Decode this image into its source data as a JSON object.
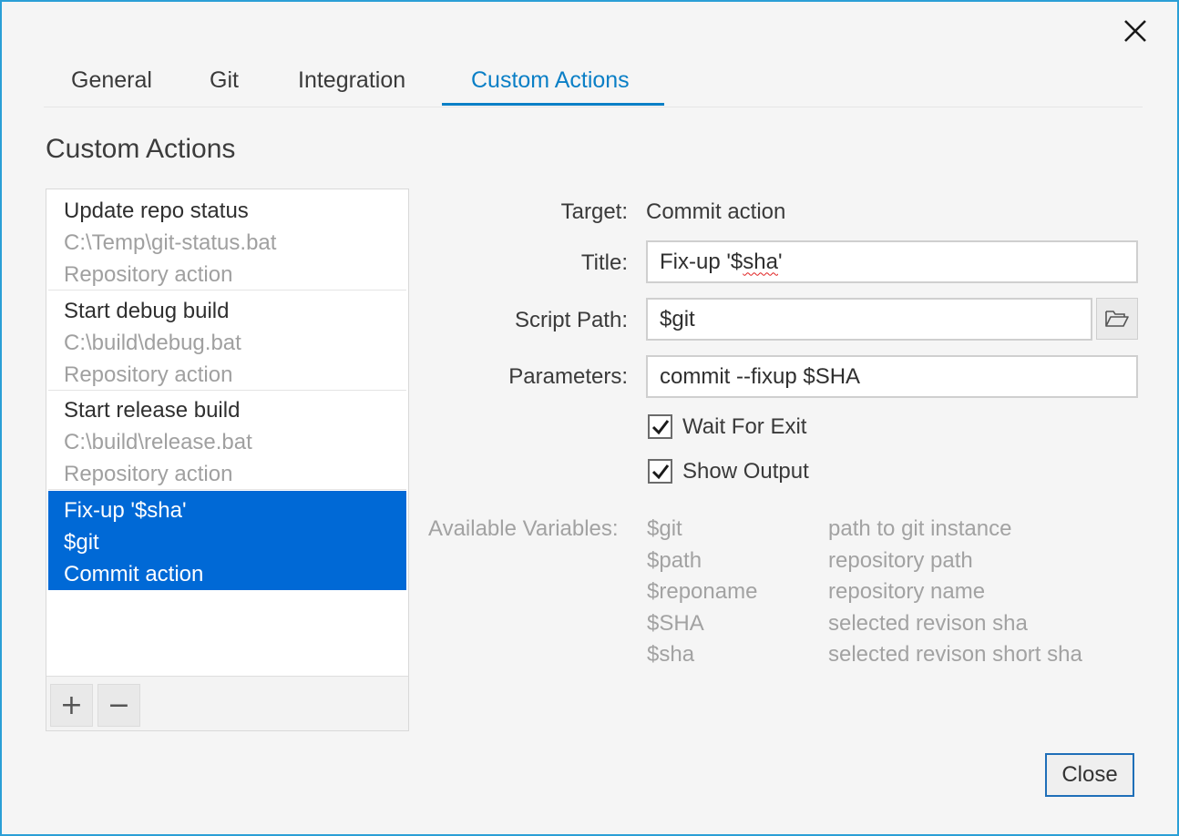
{
  "tabs": [
    {
      "label": "General"
    },
    {
      "label": "Git"
    },
    {
      "label": "Integration"
    },
    {
      "label": "Custom Actions"
    }
  ],
  "active_tab": "Custom Actions",
  "section_title": "Custom Actions",
  "actions": [
    {
      "title": "Update repo status",
      "path": "C:\\Temp\\git-status.bat",
      "target": "Repository action"
    },
    {
      "title": "Start debug build",
      "path": "C:\\build\\debug.bat",
      "target": "Repository action"
    },
    {
      "title": "Start release build",
      "path": "C:\\build\\release.bat",
      "target": "Repository action"
    },
    {
      "title": "Fix-up '$sha'",
      "path": "$git",
      "target": "Commit action"
    }
  ],
  "list_toolbar": {
    "add_label": "+",
    "remove_label": "−"
  },
  "form": {
    "target_label": "Target:",
    "target_value": "Commit action",
    "title_label": "Title:",
    "title_value_prefix": "Fix-up '$",
    "title_value_flagged": "sha",
    "title_value_suffix": "'",
    "script_path_label": "Script Path:",
    "script_path_value": "$git",
    "parameters_label": "Parameters:",
    "parameters_value": "commit --fixup $SHA",
    "wait_for_exit_label": "Wait For Exit",
    "wait_for_exit_checked": true,
    "show_output_label": "Show Output",
    "show_output_checked": true
  },
  "variables": {
    "label": "Available Variables:",
    "items": [
      {
        "name": "$git",
        "desc": "path to git instance"
      },
      {
        "name": "$path",
        "desc": "repository path"
      },
      {
        "name": "$reponame",
        "desc": "repository name"
      },
      {
        "name": "$SHA",
        "desc": "selected revison sha"
      },
      {
        "name": "$sha",
        "desc": "selected revison short sha"
      }
    ]
  },
  "close_button_label": "Close",
  "icons": {
    "dialog_close": "close-icon",
    "browse": "folder-open-icon",
    "checkbox": "checkmark-icon"
  },
  "colors": {
    "accent": "#0a7fc6",
    "selection": "#0069d6",
    "dialog_border": "#2b9fd6"
  }
}
